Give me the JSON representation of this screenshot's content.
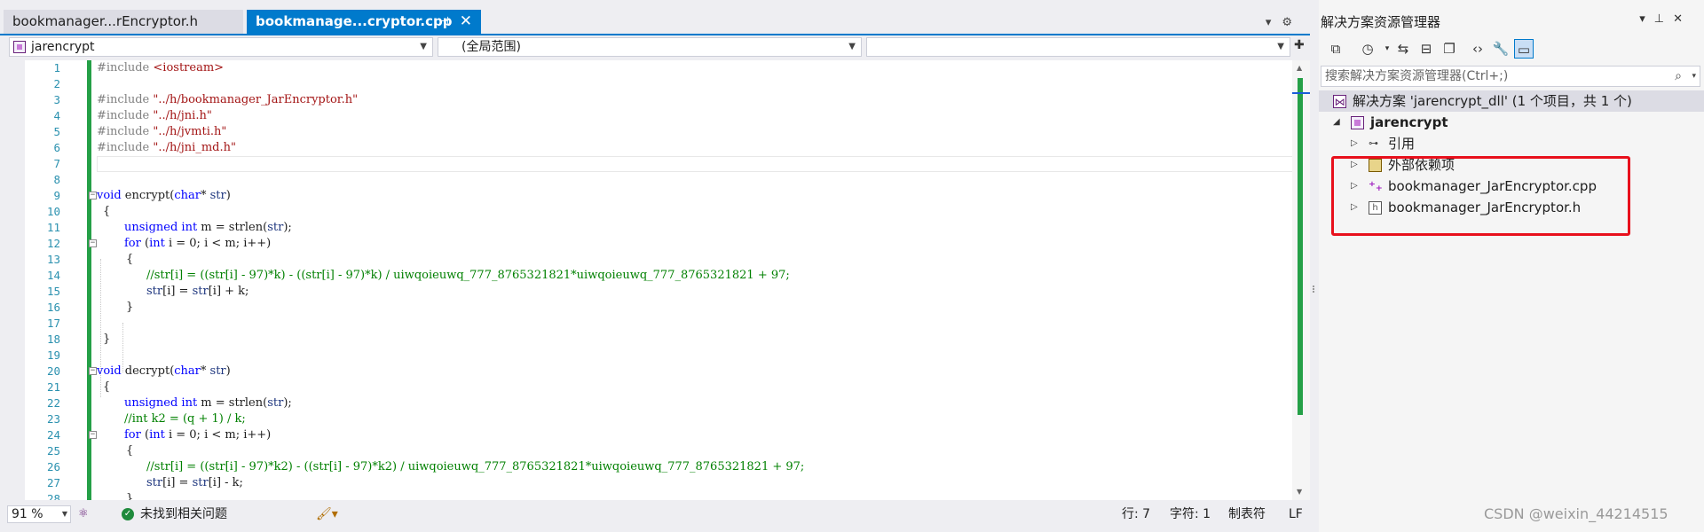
{
  "tabs": {
    "inactive_label": "bookmanager...rEncryptor.h",
    "active_label": "bookmanage...cryptor.cpp",
    "pin_icon": "pin-icon",
    "close_icon": "close-icon"
  },
  "navbar": {
    "project_scope": "jarencrypt",
    "global_scope": "(全局范围)",
    "member_scope": ""
  },
  "code_lines": [
    {
      "n": "1"
    },
    {
      "n": "2"
    },
    {
      "n": "3"
    },
    {
      "n": "4"
    },
    {
      "n": "5"
    },
    {
      "n": "6"
    },
    {
      "n": "7"
    },
    {
      "n": "8"
    },
    {
      "n": "9"
    },
    {
      "n": "10"
    },
    {
      "n": "11"
    },
    {
      "n": "12"
    },
    {
      "n": "13"
    },
    {
      "n": "14"
    },
    {
      "n": "15"
    },
    {
      "n": "16"
    },
    {
      "n": "17"
    },
    {
      "n": "18"
    },
    {
      "n": "19"
    },
    {
      "n": "20"
    },
    {
      "n": "21"
    },
    {
      "n": "22"
    },
    {
      "n": "23"
    },
    {
      "n": "24"
    },
    {
      "n": "25"
    },
    {
      "n": "26"
    },
    {
      "n": "27"
    },
    {
      "n": "28"
    }
  ],
  "code": {
    "l1_pp": "#include ",
    "l1_str": "<iostream>",
    "l3_pp": "#include ",
    "l3_str": "\"../h/bookmanager_JarEncryptor.h\"",
    "l4_pp": "#include ",
    "l4_str": "\"../h/jni.h\"",
    "l5_pp": "#include ",
    "l5_str": "\"../h/jvmti.h\"",
    "l6_pp": "#include ",
    "l6_str": "\"../h/jni_md.h\"",
    "l9_kw": "void",
    "l9_rest": " encrypt(",
    "l9_kw2": "char",
    "l9_rest2": "* ",
    "l9_id": "str",
    "l9_end": ")",
    "l10": "{",
    "l11_kw": "unsigned int",
    "l11_rest": " m = strlen(",
    "l11_id": "str",
    "l11_end": ");",
    "l12_kw": "for",
    "l12_rest": " (",
    "l12_kw2": "int",
    "l12_rest2": " i = 0; i < m; i++)",
    "l13": "{",
    "l14_cm": "//str[i] = ((str[i] - 97)*k) - ((str[i] - 97)*k) / uiwqoieuwq_777_8765321821*uiwqoieuwq_777_8765321821 + 97;",
    "l15_id": "str",
    "l15_rest": "[i] = ",
    "l15_id2": "str",
    "l15_end": "[i] + k;",
    "l16": "}",
    "l18": "}",
    "l20_kw": "void",
    "l20_rest": " decrypt(",
    "l20_kw2": "char",
    "l20_rest2": "* ",
    "l20_id": "str",
    "l20_end": ")",
    "l21": "{",
    "l22_kw": "unsigned int",
    "l22_rest": " m = strlen(",
    "l22_id": "str",
    "l22_end": ");",
    "l23_cm": "//int k2 = (q + 1) / k;",
    "l24_kw": "for",
    "l24_rest": " (",
    "l24_kw2": "int",
    "l24_rest2": " i = 0; i < m; i++)",
    "l25": "{",
    "l26_cm": "//str[i] = ((str[i] - 97)*k2) - ((str[i] - 97)*k2) / uiwqoieuwq_777_8765321821*uiwqoieuwq_777_8765321821 + 97;",
    "l27_id": "str",
    "l27_rest": "[i] = ",
    "l27_id2": "str",
    "l27_end": "[i] - k;",
    "l28": "}"
  },
  "status": {
    "zoom": "91 %",
    "issues": "未找到相关问题",
    "line": "行: 7",
    "char": "字符: 1",
    "tabs_mode": "制表符",
    "eol": "LF"
  },
  "explorer": {
    "title": "解决方案资源管理器",
    "search_placeholder": "搜索解决方案资源管理器(Ctrl+;)",
    "solution": "解决方案 'jarencrypt_dll' (1 个项目，共 1 个)",
    "project": "jarencrypt",
    "items": [
      {
        "label": "引用"
      },
      {
        "label": "外部依赖项"
      },
      {
        "label": "bookmanager_JarEncryptor.cpp"
      },
      {
        "label": "bookmanager_JarEncryptor.h"
      }
    ]
  },
  "watermark": "CSDN @weixin_44214515",
  "colors": {
    "accent": "#007acc",
    "modified_bar": "#25a047",
    "highlight_box": "#e8101c",
    "keyword": "#0000ff",
    "string": "#a31515",
    "comment": "#008000"
  }
}
